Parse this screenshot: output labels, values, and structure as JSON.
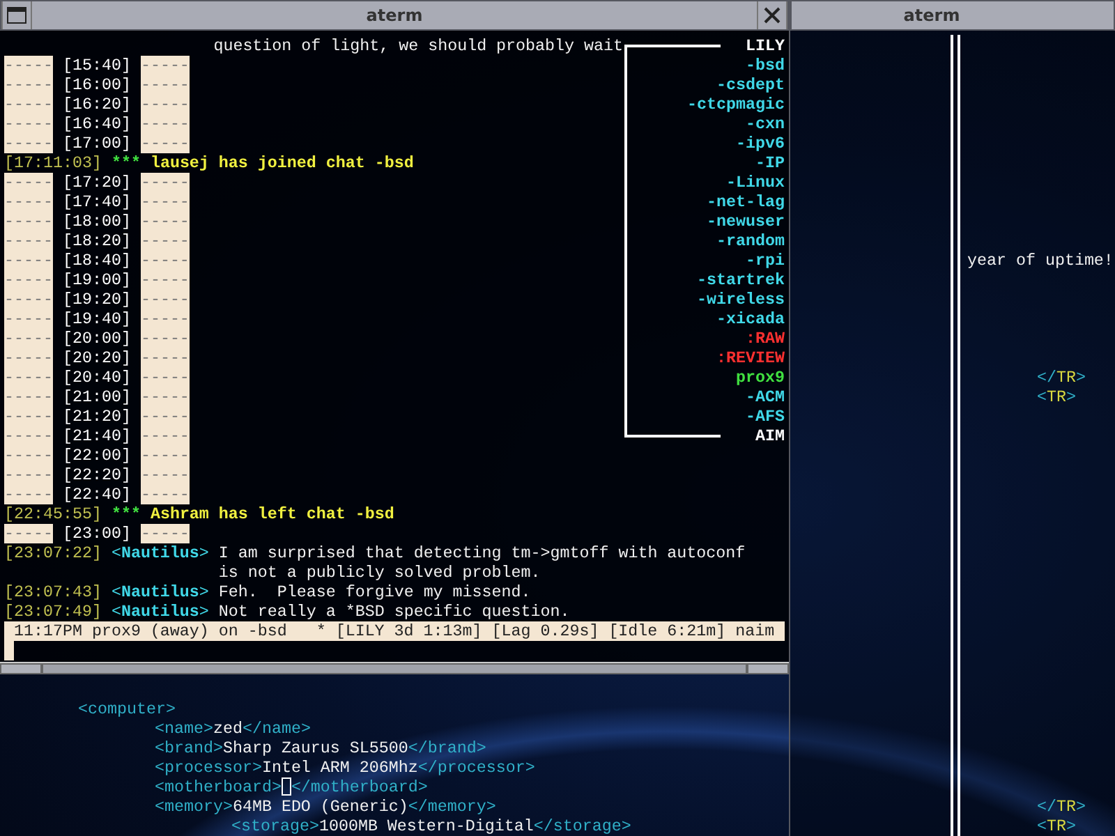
{
  "left_window": {
    "title": "aterm",
    "chat": [
      {
        "kind": "continuation",
        "text": "question of light, we should probably wait"
      },
      {
        "kind": "divider",
        "left": "-----",
        "time": "[15:40]",
        "right": "-----"
      },
      {
        "kind": "divider",
        "left": "-----",
        "time": "[16:00]",
        "right": "-----"
      },
      {
        "kind": "divider",
        "left": "-----",
        "time": "[16:20]",
        "right": "-----"
      },
      {
        "kind": "divider",
        "left": "-----",
        "time": "[16:40]",
        "right": "-----"
      },
      {
        "kind": "divider",
        "left": "-----",
        "time": "[17:00]",
        "right": "-----"
      },
      {
        "kind": "event",
        "timestamp": "[17:11:03]",
        "marker": "***",
        "text": "lausej has joined chat -bsd"
      },
      {
        "kind": "divider",
        "left": "-----",
        "time": "[17:20]",
        "right": "-----"
      },
      {
        "kind": "divider",
        "left": "-----",
        "time": "[17:40]",
        "right": "-----"
      },
      {
        "kind": "divider",
        "left": "-----",
        "time": "[18:00]",
        "right": "-----"
      },
      {
        "kind": "divider",
        "left": "-----",
        "time": "[18:20]",
        "right": "-----"
      },
      {
        "kind": "divider",
        "left": "-----",
        "time": "[18:40]",
        "right": "-----"
      },
      {
        "kind": "divider",
        "left": "-----",
        "time": "[19:00]",
        "right": "-----"
      },
      {
        "kind": "divider",
        "left": "-----",
        "time": "[19:20]",
        "right": "-----"
      },
      {
        "kind": "divider",
        "left": "-----",
        "time": "[19:40]",
        "right": "-----"
      },
      {
        "kind": "divider",
        "left": "-----",
        "time": "[20:00]",
        "right": "-----"
      },
      {
        "kind": "divider",
        "left": "-----",
        "time": "[20:20]",
        "right": "-----"
      },
      {
        "kind": "divider",
        "left": "-----",
        "time": "[20:40]",
        "right": "-----"
      },
      {
        "kind": "divider",
        "left": "-----",
        "time": "[21:00]",
        "right": "-----"
      },
      {
        "kind": "divider",
        "left": "-----",
        "time": "[21:20]",
        "right": "-----"
      },
      {
        "kind": "divider",
        "left": "-----",
        "time": "[21:40]",
        "right": "-----"
      },
      {
        "kind": "divider",
        "left": "-----",
        "time": "[22:00]",
        "right": "-----"
      },
      {
        "kind": "divider",
        "left": "-----",
        "time": "[22:20]",
        "right": "-----"
      },
      {
        "kind": "divider",
        "left": "-----",
        "time": "[22:40]",
        "right": "-----"
      },
      {
        "kind": "event",
        "timestamp": "[22:45:55]",
        "marker": "***",
        "text": "Ashram has left chat -bsd"
      },
      {
        "kind": "divider",
        "left": "-----",
        "time": "[23:00]",
        "right": "-----"
      },
      {
        "kind": "message",
        "timestamp": "[23:07:22]",
        "nick": "<**Nautilus**>",
        "lines": [
          "I am surprised that detecting tm->gmtoff with autoconf",
          "is not a publicly solved problem."
        ]
      },
      {
        "kind": "message",
        "timestamp": "[23:07:43]",
        "nick": "<**Nautilus**>",
        "lines": [
          "Feh.  Please forgive my missend."
        ]
      },
      {
        "kind": "message",
        "timestamp": "[23:07:49]",
        "nick": "<**Nautilus**>",
        "lines": [
          "Not really a *BSD specific question."
        ]
      }
    ],
    "channels": [
      {
        "name": "LILY",
        "color": "#ffffff"
      },
      {
        "name": "-bsd",
        "color": "#40d8e8"
      },
      {
        "name": "-csdept",
        "color": "#40d8e8"
      },
      {
        "name": "-ctcpmagic",
        "color": "#40d8e8"
      },
      {
        "name": "-cxn",
        "color": "#40d8e8"
      },
      {
        "name": "-ipv6",
        "color": "#40d8e8"
      },
      {
        "name": "-IP",
        "color": "#40d8e8"
      },
      {
        "name": "-Linux",
        "color": "#40d8e8"
      },
      {
        "name": "-net-lag",
        "color": "#40d8e8"
      },
      {
        "name": "-newuser",
        "color": "#40d8e8"
      },
      {
        "name": "-random",
        "color": "#40d8e8"
      },
      {
        "name": "-rpi",
        "color": "#40d8e8"
      },
      {
        "name": "-startrek",
        "color": "#40d8e8"
      },
      {
        "name": "-wireless",
        "color": "#40d8e8"
      },
      {
        "name": "-xicada",
        "color": "#40d8e8"
      },
      {
        "name": ":RAW",
        "color": "#ff3030"
      },
      {
        "name": ":REVIEW",
        "color": "#ff3030"
      },
      {
        "name": "prox9",
        "color": "#40e040"
      },
      {
        "name": "-ACM",
        "color": "#40d8e8"
      },
      {
        "name": "-AFS",
        "color": "#40d8e8"
      },
      {
        "name": "AIM",
        "color": "#ffffff"
      }
    ],
    "status_bar": "11:17PM prox9 (away) on -bsd   * [LILY 3d 1:13m] [Lag 0.29s] [Idle 6:21m] naim"
  },
  "background_terminal": {
    "xml": [
      {
        "open": "<computer>",
        "children": [
          {
            "open": "<name>",
            "value": "zed",
            "close": "</name>"
          },
          {
            "open": "<brand>",
            "value": "Sharp Zaurus SL5500",
            "close": "</brand>"
          },
          {
            "open": "<processor>",
            "value": "Intel ARM 206Mhz",
            "close": "</processor>"
          },
          {
            "open": "<motherboard>",
            "cursor": true,
            "close": "</motherboard>"
          },
          {
            "open": "<memory>",
            "value": "64MB EDO (Generic)",
            "close": "</memory>",
            "children": [
              {
                "open": "<storage>",
                "value": "1000MB Western-Digital",
                "close": "</storage>"
              }
            ]
          }
        ]
      }
    ]
  },
  "right_window": {
    "title": "aterm",
    "uptime_text": "year of uptime!",
    "markup_top": [
      {
        "open": "</",
        "name": "TR",
        "end": ">"
      },
      {
        "open": "<",
        "name": "TR",
        "end": ">"
      }
    ],
    "markup_bottom": [
      {
        "open": "</",
        "name": "TR",
        "end": ">"
      },
      {
        "open": "<",
        "name": "TR",
        "end": ">"
      }
    ]
  }
}
